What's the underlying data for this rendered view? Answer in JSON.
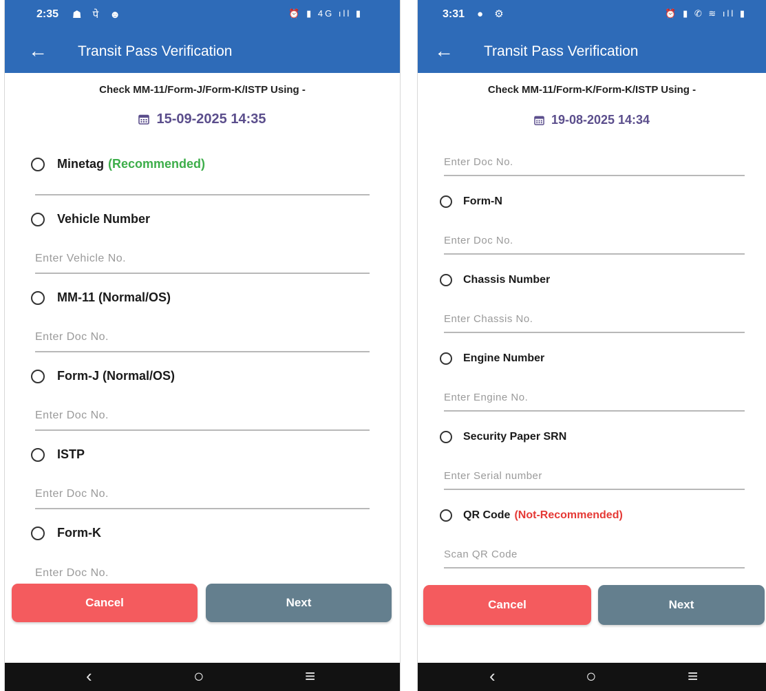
{
  "left": {
    "status": {
      "time": "2:35",
      "left_icons": "☗ पे ☻",
      "right_icons": "⏰ ▮ 4G ıll ▮"
    },
    "header": {
      "back_icon": "←",
      "title": "Transit Pass Verification"
    },
    "subtitle": "Check MM-11/Form-J/Form-K/ISTP Using -",
    "datetime": "15-09-2025 14:35",
    "options": [
      {
        "label": "Minetag",
        "tag": "(Recommended)",
        "placeholder": ""
      },
      {
        "label": "Vehicle Number",
        "placeholder": "Enter Vehicle No."
      },
      {
        "label": "MM-11 (Normal/OS)",
        "placeholder": "Enter Doc No."
      },
      {
        "label": "Form-J (Normal/OS)",
        "placeholder": "Enter Doc No."
      },
      {
        "label": "ISTP",
        "placeholder": "Enter Doc No."
      },
      {
        "label": "Form-K",
        "placeholder": "Enter Doc No."
      }
    ],
    "buttons": {
      "cancel": "Cancel",
      "next": "Next"
    }
  },
  "right": {
    "status": {
      "time": "3:31",
      "left_icons": "● ⚙",
      "right_icons": "⏰ ▮ ✆ ≋ ıll ▮"
    },
    "header": {
      "back_icon": "←",
      "title": "Transit Pass Verification"
    },
    "subtitle": "Check MM-11/Form-K/Form-K/ISTP Using -",
    "datetime": "19-08-2025 14:34",
    "top_field_placeholder": "Enter Doc No.",
    "options": [
      {
        "label": "Form-N",
        "placeholder": "Enter Doc No."
      },
      {
        "label": "Chassis Number",
        "placeholder": "Enter Chassis No."
      },
      {
        "label": "Engine Number",
        "placeholder": "Enter Engine No."
      },
      {
        "label": "Security Paper SRN",
        "placeholder": "Enter Serial number"
      },
      {
        "label": "QR Code",
        "tag": "(Not-Recommended)",
        "placeholder": "Scan QR Code"
      }
    ],
    "buttons": {
      "cancel": "Cancel",
      "next": "Next"
    }
  },
  "nav": {
    "back": "‹",
    "home": "○",
    "menu": "≡"
  },
  "colors": {
    "app_bar": "#2e6bb8",
    "date_text": "#5b4e8c",
    "recommended": "#3dae4a",
    "not_recommended": "#e53935",
    "cancel_button": "#f45b5e",
    "next_button": "#647f8e"
  }
}
